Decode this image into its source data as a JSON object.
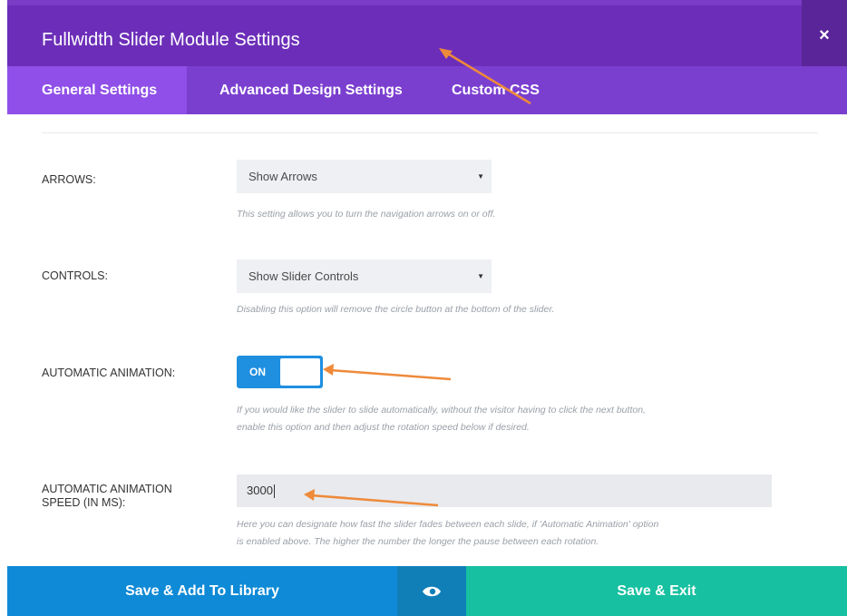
{
  "header": {
    "title": "Fullwidth Slider Module Settings",
    "close_label": "×"
  },
  "tabs": [
    {
      "label": "General Settings",
      "active": true
    },
    {
      "label": "Advanced Design Settings",
      "active": false
    },
    {
      "label": "Custom CSS",
      "active": false
    }
  ],
  "settings": {
    "arrows": {
      "label": "ARROWS:",
      "value": "Show Arrows",
      "description": "This setting allows you to turn the navigation arrows on or off."
    },
    "controls": {
      "label": "CONTROLS:",
      "value": "Show Slider Controls",
      "description": "Disabling this option will remove the circle button at the bottom of the slider."
    },
    "auto_animation": {
      "label": "AUTOMATIC ANIMATION:",
      "toggle_label": "ON",
      "description_line1": "If you would like the slider to slide automatically, without the visitor having to click the next button,",
      "description_line2": "enable this option and then adjust the rotation speed below if desired."
    },
    "auto_speed": {
      "label_line1": "AUTOMATIC ANIMATION",
      "label_line2": "SPEED (IN MS):",
      "value": "3000",
      "description_line1": "Here you can designate how fast the slider fades between each slide, if 'Automatic Animation' option",
      "description_line2": "is enabled above. The higher the number the longer the pause between each rotation."
    }
  },
  "footer": {
    "save_library_label": "Save & Add To Library",
    "preview_icon": "eye-icon",
    "save_exit_label": "Save & Exit"
  },
  "colors": {
    "header": "#6c2eb9",
    "tabs": "#7b3fd0",
    "active_tab": "#8f4fe8",
    "toggle": "#1f8fe0",
    "save_library": "#0e8ad6",
    "save_exit": "#16c0a0",
    "annotation_arrow": "#ee8a3a"
  }
}
